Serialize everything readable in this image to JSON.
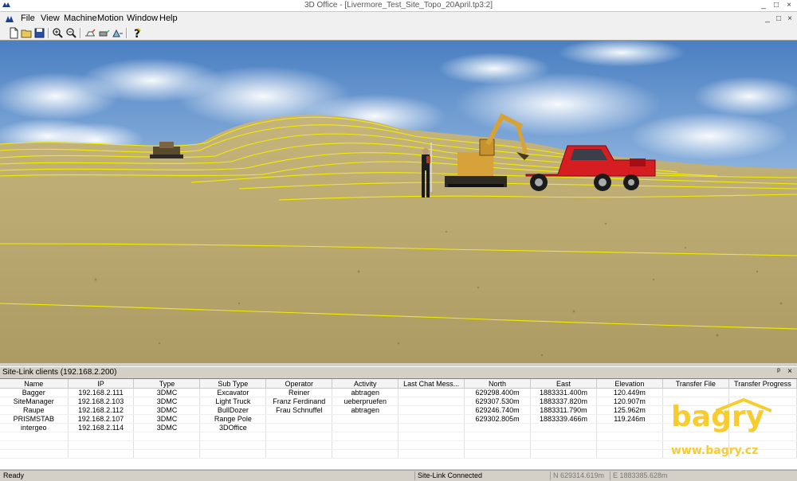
{
  "window": {
    "title": "3D Office - [Livermore_Test_Site_Topo_20April.tp3:2]",
    "controls": [
      "_",
      "□",
      "×"
    ],
    "mdi_controls": [
      "_",
      "□",
      "×"
    ]
  },
  "menu": {
    "items": [
      "File",
      "View",
      "Machine",
      "Motion",
      "Window",
      "Help"
    ]
  },
  "toolbar": {
    "buttons": [
      "new-file-icon",
      "open-folder-icon",
      "save-icon",
      "zoom-in-icon",
      "zoom-out-icon",
      "machine-tool-1-icon",
      "machine-tool-2-icon",
      "machine-tool-3-icon",
      "help-icon"
    ]
  },
  "panel": {
    "title": "Site-Link clients (192.168.2.200)",
    "buttons": [
      "ᵖ",
      "×"
    ]
  },
  "table": {
    "columns": [
      "Name",
      "IP",
      "Type",
      "Sub Type",
      "Operator",
      "Activity",
      "Last Chat Mess...",
      "North",
      "East",
      "Elevation",
      "Transfer File",
      "Transfer Progress"
    ],
    "rows": [
      [
        "Bagger",
        "192.168.2.111",
        "3DMC",
        "Excavator",
        "Reiner",
        "abtragen",
        "",
        "629298.400m",
        "1883331.400m",
        "120.449m",
        "",
        ""
      ],
      [
        "SiteManager",
        "192.168.2.103",
        "3DMC",
        "Light Truck",
        "Franz Ferdinand",
        "ueberpruefen",
        "",
        "629307.530m",
        "1883337.820m",
        "120.907m",
        "",
        ""
      ],
      [
        "Raupe",
        "192.168.2.112",
        "3DMC",
        "BullDozer",
        "Frau Schnuffel",
        "abtragen",
        "",
        "629246.740m",
        "1883311.790m",
        "125.962m",
        "",
        ""
      ],
      [
        "PRISMSTAB",
        "192.168.2.107",
        "3DMC",
        "Range Pole",
        "",
        "",
        "",
        "629302.805m",
        "1883339.466m",
        "119.246m",
        "",
        ""
      ],
      [
        "intergeo",
        "192.168.2.114",
        "3DMC",
        "3DOffice",
        "",
        "",
        "",
        "",
        "",
        "",
        "",
        ""
      ]
    ]
  },
  "status": {
    "ready": "Ready",
    "connection": "Site-Link Connected",
    "north": "N 629314.619m",
    "east": "E 1883385.628m"
  },
  "watermark": {
    "logo": "bagry",
    "url": "www.bagry.cz"
  },
  "colors": {
    "contour": "#f2ee00",
    "terrain": "#b9a96e",
    "sky": "#5a8cc8",
    "truck": "#d61d22",
    "excavator": "#d8a23a",
    "watermark": "#f6cc2e"
  }
}
